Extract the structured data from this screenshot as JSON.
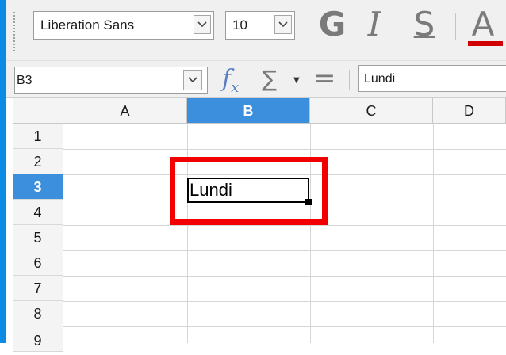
{
  "toolbar": {
    "font_name": "Liberation Sans",
    "font_size": "10",
    "bold_label": "G",
    "italic_label": "I",
    "underline_label": "S",
    "font_color_label": "A",
    "font_color_bar": "#d00000"
  },
  "formula_bar": {
    "name_box": "B3",
    "function_wizard_label": "f",
    "function_wizard_sub": "x",
    "sum_label": "∑",
    "equals_label": "=",
    "input_value": "Lundi"
  },
  "sheet": {
    "columns": [
      "A",
      "B",
      "C",
      "D"
    ],
    "selected_column": "B",
    "rows": [
      "1",
      "2",
      "3",
      "4",
      "5",
      "6",
      "7",
      "8",
      "9"
    ],
    "selected_row": "3",
    "active_cell": "B3",
    "active_cell_value": "Lundi"
  },
  "colors": {
    "accent": "#3c8fdc",
    "left_stripe": "#0b8be3",
    "highlight_box": "#f20000"
  }
}
